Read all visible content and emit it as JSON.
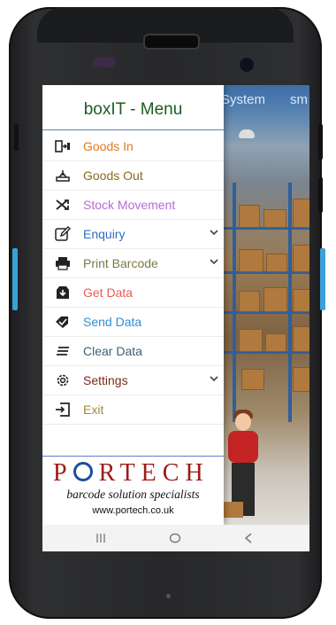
{
  "drawer": {
    "title": "boxIT -  Menu",
    "items": [
      {
        "label": "Goods In",
        "color": "#e07b1a",
        "icon": "goods-in-icon",
        "has_chevron": false
      },
      {
        "label": "Goods Out",
        "color": "#8a6a1f",
        "icon": "goods-out-icon",
        "has_chevron": false
      },
      {
        "label": "Stock Movement",
        "color": "#b86ad9",
        "icon": "shuffle-icon",
        "has_chevron": false
      },
      {
        "label": "Enquiry",
        "color": "#2f6fc9",
        "icon": "edit-icon",
        "has_chevron": true
      },
      {
        "label": "Print Barcode",
        "color": "#7c7a45",
        "icon": "printer-icon",
        "has_chevron": true
      },
      {
        "label": "Get Data",
        "color": "#f05a4f",
        "icon": "download-icon",
        "has_chevron": false
      },
      {
        "label": "Send Data",
        "color": "#2b8fd6",
        "icon": "send-icon",
        "has_chevron": false
      },
      {
        "label": "Clear Data",
        "color": "#3f5f6f",
        "icon": "clear-icon",
        "has_chevron": false
      },
      {
        "label": "Settings",
        "color": "#7a2a1a",
        "icon": "gear-icon",
        "has_chevron": true
      },
      {
        "label": "Exit",
        "color": "#a08a3a",
        "icon": "exit-icon",
        "has_chevron": false
      }
    ]
  },
  "branding": {
    "logo_text_first": "P",
    "logo_text_rest": "RTECH",
    "tagline": "barcode solution specialists",
    "url": "www.portech.co.uk",
    "logo_color": "#9b1b1b",
    "accent_color": "#1f4d9c"
  },
  "background": {
    "tab_system": "System",
    "tab_partial": "sm"
  },
  "navbar": {
    "recents_icon": "recents-icon",
    "home_icon": "home-icon",
    "back_icon": "back-icon"
  }
}
